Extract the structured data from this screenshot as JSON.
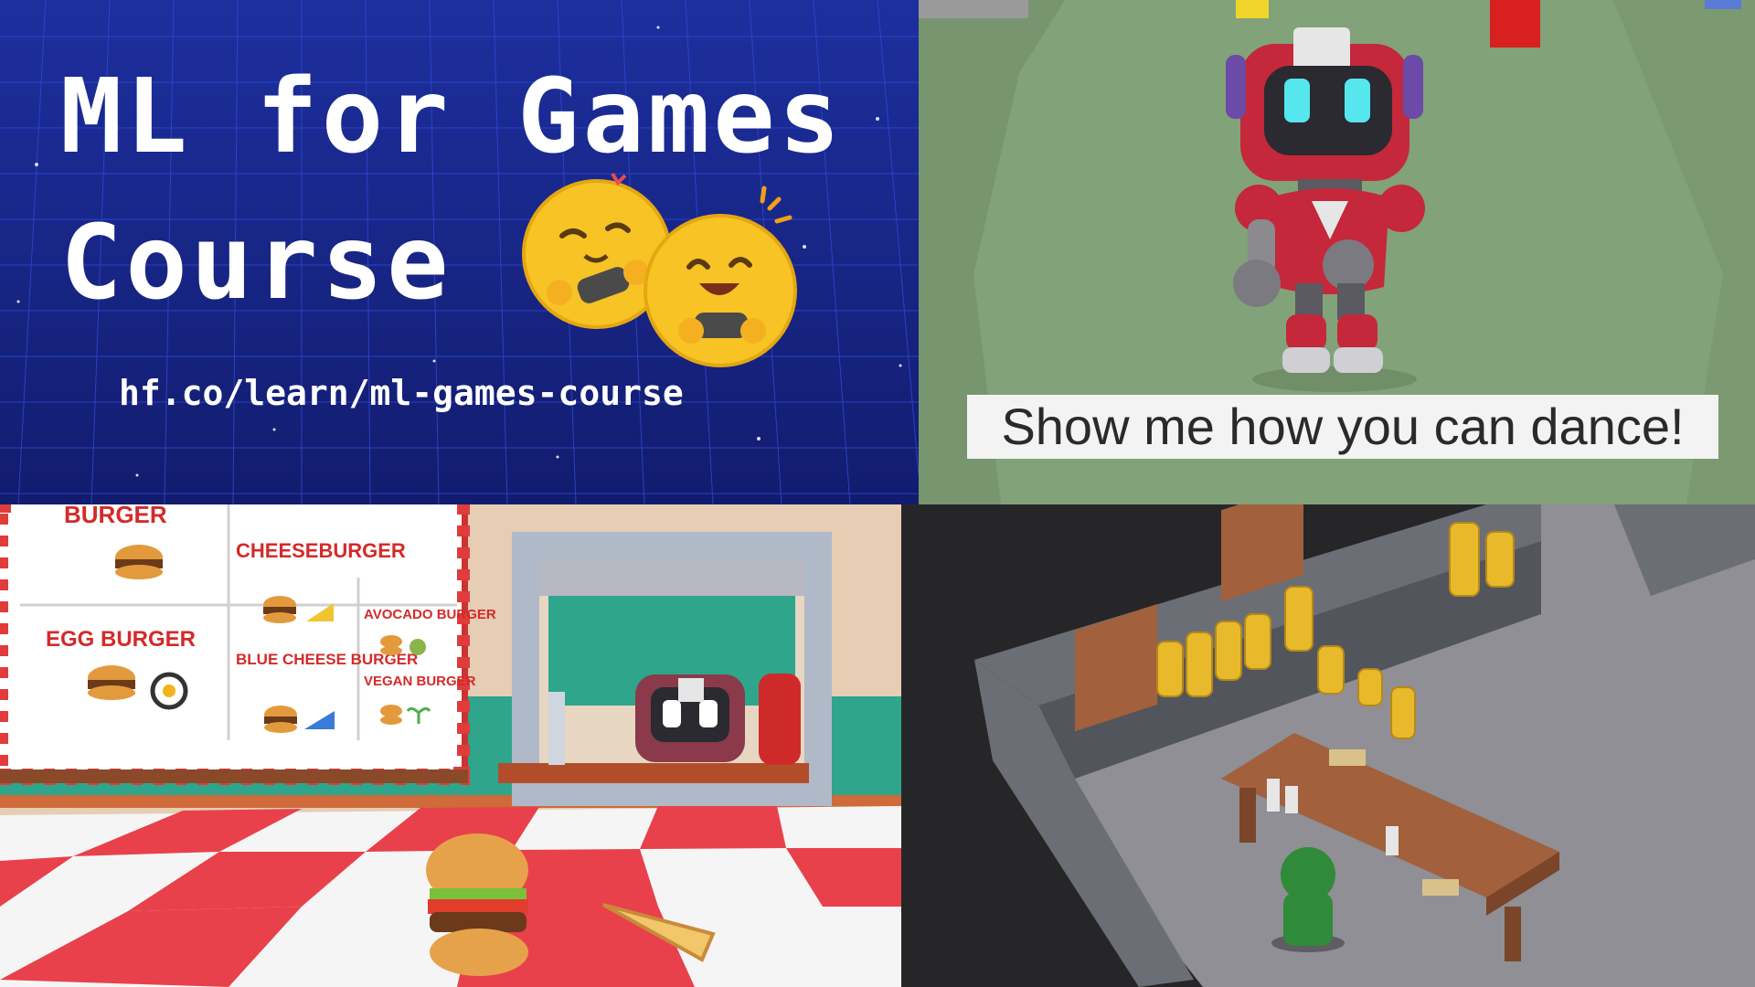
{
  "course_banner": {
    "title_line1": "ML for Games",
    "title_line2": "Course",
    "url": "hf.co/learn/ml-games-course",
    "colors": {
      "background": "#16227a",
      "grid": "#2f4bd8",
      "text": "#ffffff"
    },
    "icons": [
      "emoji-face-playing-game-icon",
      "emoji-face-happy-game-icon"
    ]
  },
  "robot_scene": {
    "subtitle": "Show me how you can dance!",
    "colors": {
      "ground": "#7f9f74",
      "robot_body": "#c8283a",
      "robot_eyes": "#56e6ee"
    }
  },
  "burger_scene": {
    "menu_items": [
      {
        "label": "BURGER",
        "icons": [
          "burger-icon"
        ]
      },
      {
        "label": "CHEESEBURGER",
        "icons": [
          "burger-icon",
          "cheese-icon"
        ]
      },
      {
        "label": "AVOCADO BURGER",
        "icons": [
          "burger-icon",
          "avocado-icon"
        ]
      },
      {
        "label": "EGG BURGER",
        "icons": [
          "burger-icon",
          "egg-icon"
        ]
      },
      {
        "label": "BLUE CHEESE BURGER",
        "icons": [
          "burger-icon",
          "blue-cheese-icon"
        ]
      },
      {
        "label": "VEGAN BURGER",
        "icons": [
          "burger-icon",
          "sprout-icon"
        ]
      }
    ],
    "colors": {
      "menu_text": "#d42a2a",
      "checker": "#e8414b",
      "wall": "#2fa58c"
    }
  },
  "dungeon_scene": {
    "colors": {
      "wall_stone": "#6b6e74",
      "floor": "#8f8f95",
      "gold": "#e8b92a",
      "wood": "#a2603c"
    }
  }
}
